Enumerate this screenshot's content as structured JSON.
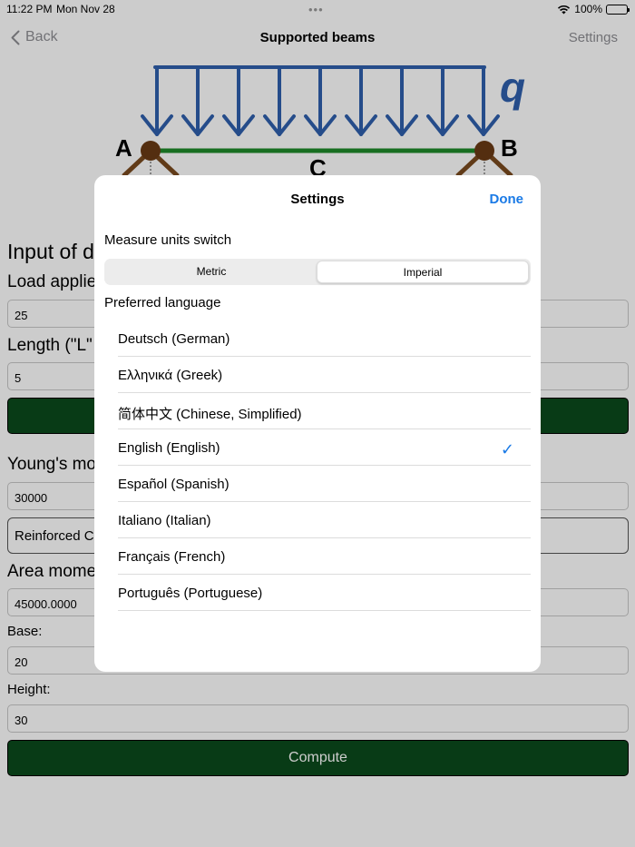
{
  "status": {
    "time": "11:22 PM",
    "date": "Mon Nov 28",
    "battery": "100%"
  },
  "nav": {
    "back_label": "Back",
    "title": "Supported beams",
    "settings_label": "Settings"
  },
  "diagram": {
    "load_label": "q",
    "support_a": "A",
    "support_b": "B",
    "midpoint": "C"
  },
  "form": {
    "section_title": "Input of d",
    "load_label": "Load applie",
    "load_value": "25",
    "length_label": "Length (\"L\"",
    "length_value": "5",
    "youngs_label": "Young's mo",
    "youngs_value": "30000",
    "material_value": "Reinforced C",
    "area_label": "Area mome",
    "area_value": "45000.0000",
    "base_label": "Base:",
    "base_value": "20",
    "height_label": "Height:",
    "height_value": "30",
    "compute_label": "Compute"
  },
  "settings_sheet": {
    "title": "Settings",
    "done_label": "Done",
    "units_label": "Measure units switch",
    "units": [
      {
        "label": "Metric",
        "selected": false
      },
      {
        "label": "Imperial",
        "selected": true
      }
    ],
    "language_label": "Preferred language",
    "languages": [
      {
        "label": "Deutsch (German)",
        "selected": false
      },
      {
        "label": "Ελληνικά (Greek)",
        "selected": false
      },
      {
        "label": "简体中文 (Chinese, Simplified)",
        "selected": false
      },
      {
        "label": "English (English)",
        "selected": true
      },
      {
        "label": "Español (Spanish)",
        "selected": false
      },
      {
        "label": "Italiano (Italian)",
        "selected": false
      },
      {
        "label": "Français (French)",
        "selected": false
      },
      {
        "label": "Português (Portuguese)",
        "selected": false
      }
    ],
    "check_glyph": "✓"
  },
  "colors": {
    "accent": "#1a7ae6",
    "load_arrows": "#2f5fad",
    "beam": "#1e8a2a",
    "support": "#7a4a1e",
    "button_green": "#0a4a1c"
  }
}
